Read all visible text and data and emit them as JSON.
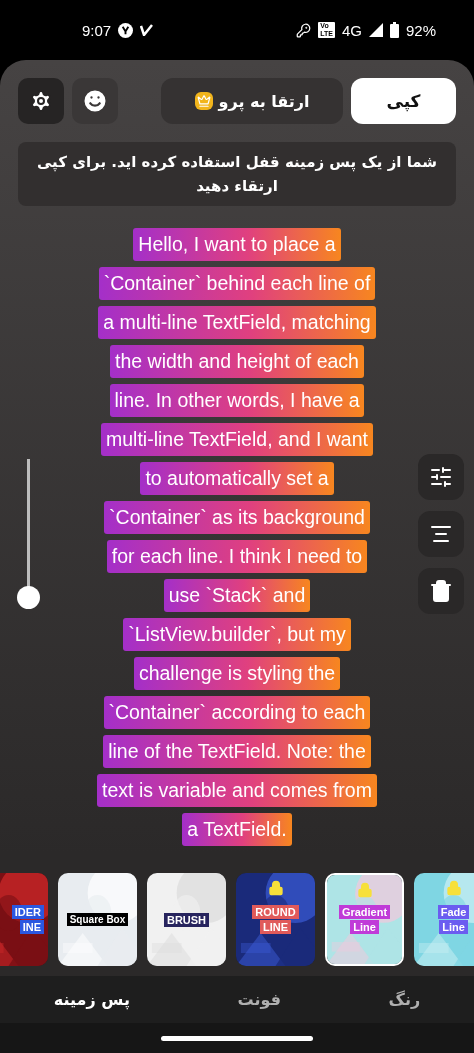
{
  "status_bar": {
    "time": "9:07",
    "network": "4G",
    "volte": [
      "Vo",
      "LTE"
    ],
    "battery": "92%"
  },
  "toolbar": {
    "copy_button": "کپی",
    "upgrade_button": "ارتقا به پرو"
  },
  "notice": "شما از یک پس زمینه قفل استفاده کرده اید. برای کپی ارتقاء دهید",
  "size_slider": {
    "level": 0
  },
  "text_lines": [
    "Hello, I want to place a",
    "`Container` behind each line of",
    "a multi-line TextField, matching",
    "the width and height of each",
    "line. In other words, I have a",
    "multi-line TextField, and I want",
    "to automatically set a",
    "`Container` as its background",
    "for each line. I think I need to",
    "use `Stack` and",
    "`ListView.builder`, but my",
    "challenge is styling the",
    "`Container` according to each",
    "line of the TextField. Note: the",
    "text is variable and comes from",
    "a TextField."
  ],
  "styles": [
    {
      "kind": "picture",
      "labels": [
        "IDER",
        "INE"
      ],
      "locked": false,
      "selected": false
    },
    {
      "kind": "picture",
      "labels": [
        "Square Box"
      ],
      "locked": false,
      "selected": false
    },
    {
      "kind": "picture",
      "labels": [
        "BRUSH"
      ],
      "locked": false,
      "selected": false
    },
    {
      "kind": "picture",
      "labels": [
        "ROUND",
        "LINE"
      ],
      "locked": true,
      "selected": false
    },
    {
      "kind": "picture",
      "labels": [
        "Gradient",
        "Line"
      ],
      "locked": true,
      "selected": true
    },
    {
      "kind": "picture",
      "labels": [
        "Fade",
        "Line"
      ],
      "locked": true,
      "selected": false
    }
  ],
  "tabs": [
    {
      "label": "رنگ",
      "selected": false
    },
    {
      "label": "فونت",
      "selected": false
    },
    {
      "label": "پس زمینه",
      "selected": true
    }
  ]
}
